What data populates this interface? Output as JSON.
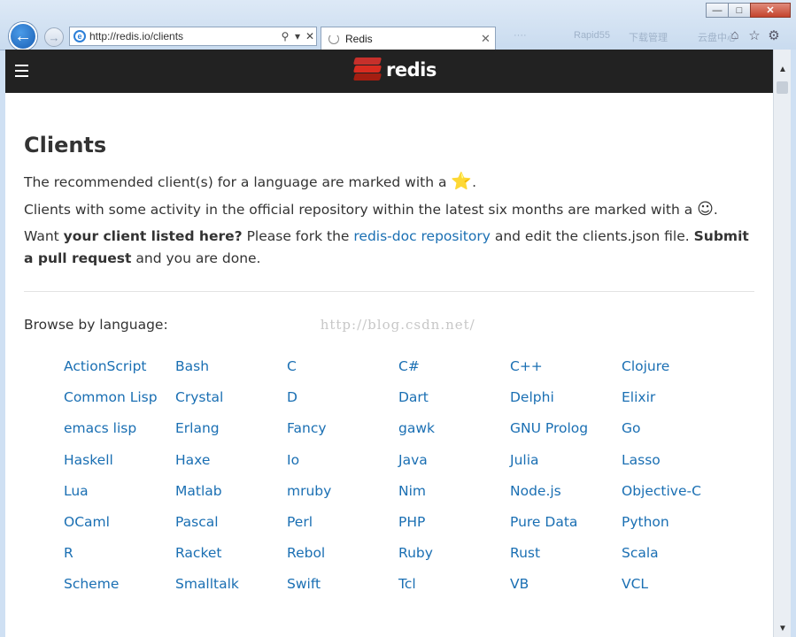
{
  "browser": {
    "url": "http://redis.io/clients",
    "tab_title": "Redis",
    "faded_bookmarks": [
      "····",
      "Rapid55",
      "下载管理",
      "云盘中心"
    ]
  },
  "site": {
    "logo_text": "redis"
  },
  "page": {
    "title": "Clients",
    "line1_text": "The recommended client(s) for a language are marked with a ",
    "line1_end": ".",
    "line2_text": "Clients with some activity in the official repository within the latest six months are marked with a ",
    "line2_end": ".",
    "line3_a": "Want ",
    "line3_b": "your client listed here?",
    "line3_c": " Please fork the ",
    "line3_link": "redis-doc repository",
    "line3_d": " and edit the clients.json file. ",
    "line3_e": "Submit a pull request",
    "line3_f": " and you are done.",
    "browse_label": "Browse by language:",
    "watermark": "http://blog.csdn.net/"
  },
  "languages": [
    "ActionScript",
    "Bash",
    "C",
    "C#",
    "C++",
    "Clojure",
    "Common Lisp",
    "Crystal",
    "D",
    "Dart",
    "Delphi",
    "Elixir",
    "emacs lisp",
    "Erlang",
    "Fancy",
    "gawk",
    "GNU Prolog",
    "Go",
    "Haskell",
    "Haxe",
    "Io",
    "Java",
    "Julia",
    "Lasso",
    "Lua",
    "Matlab",
    "mruby",
    "Nim",
    "Node.js",
    "Objective-C",
    "OCaml",
    "Pascal",
    "Perl",
    "PHP",
    "Pure Data",
    "Python",
    "R",
    "Racket",
    "Rebol",
    "Ruby",
    "Rust",
    "Scala",
    "Scheme",
    "Smalltalk",
    "Swift",
    "Tcl",
    "VB",
    "VCL"
  ],
  "icons": {
    "star": "⭐",
    "smile": "☺"
  }
}
